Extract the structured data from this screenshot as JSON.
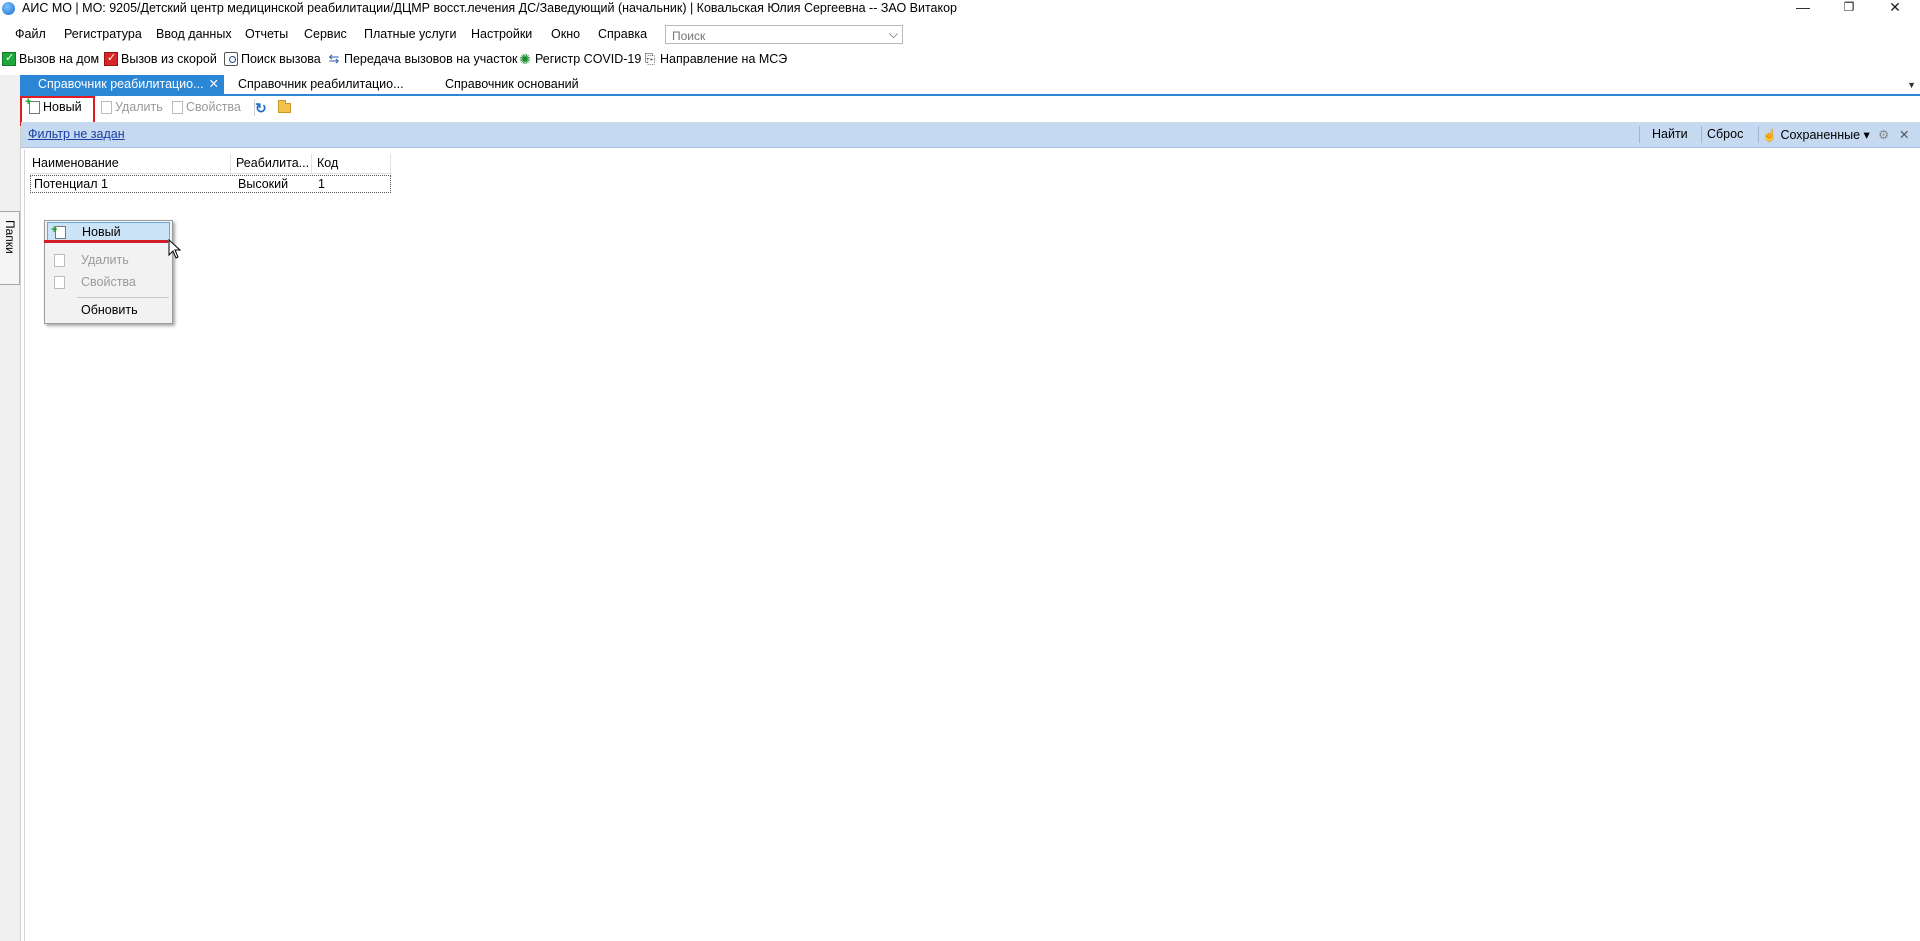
{
  "window": {
    "title": "АИС МО | МО: 9205/Детский центр медицинской реабилитации/ДЦМР восст.лечения ДС/Заведующий (начальник) | Ковальская Юлия Сергеевна -- ЗАО Витакор",
    "controls": {
      "minimize": "—",
      "restore": "❐",
      "close": "✕"
    }
  },
  "menubar": {
    "items": [
      "Файл",
      "Регистратура",
      "Ввод данных",
      "Отчеты",
      "Сервис",
      "Платные услуги",
      "Настройки",
      "Окно",
      "Справка"
    ],
    "search_placeholder": "Поиск"
  },
  "quickbar": {
    "items": [
      {
        "label": "Вызов на дом",
        "icon": "home-call-icon",
        "color": "#1ea73b"
      },
      {
        "label": "Вызов из скорой",
        "icon": "ambulance-call-icon",
        "color": "#d62626"
      },
      {
        "label": "Поиск вызова",
        "icon": "search-call-icon"
      },
      {
        "label": "Передача вызовов на участок",
        "icon": "transfer-icon"
      },
      {
        "label": "Регистр COVID-19",
        "icon": "virus-icon",
        "color": "#1a8c2f"
      },
      {
        "label": "Направление на МСЭ",
        "icon": "referral-icon"
      }
    ]
  },
  "tabs": [
    {
      "label": "Справочник реабилитацио...",
      "active": true,
      "close": "✕"
    },
    {
      "label": "Справочник реабилитацио...",
      "active": false
    },
    {
      "label": "Справочник оснований",
      "active": false
    }
  ],
  "sidepanel": {
    "label": "Папки"
  },
  "toolbar": {
    "new_label": "Новый",
    "delete_label": "Удалить",
    "properties_label": "Свойства"
  },
  "filterbar": {
    "filter_link": "Фильтр не задан",
    "find_label": "Найти",
    "reset_label": "Сброс",
    "saved_label": "Сохраненные",
    "saved_arrow": "▾",
    "close": "✕"
  },
  "grid": {
    "columns": [
      "Наименование",
      "Реабилита...",
      "Код"
    ],
    "rows": [
      [
        "Потенциал 1",
        "Высокий",
        "1"
      ]
    ]
  },
  "context_menu": {
    "items": [
      {
        "label": "Новый",
        "state": "selected"
      },
      {
        "label": "Удалить",
        "state": "disabled"
      },
      {
        "label": "Свойства",
        "state": "disabled"
      },
      {
        "label": "Обновить",
        "state": "enabled"
      }
    ]
  },
  "colors": {
    "accent": "#2b87d6",
    "filterbar": "#c5d9f1",
    "highlight": "#e01b24"
  }
}
